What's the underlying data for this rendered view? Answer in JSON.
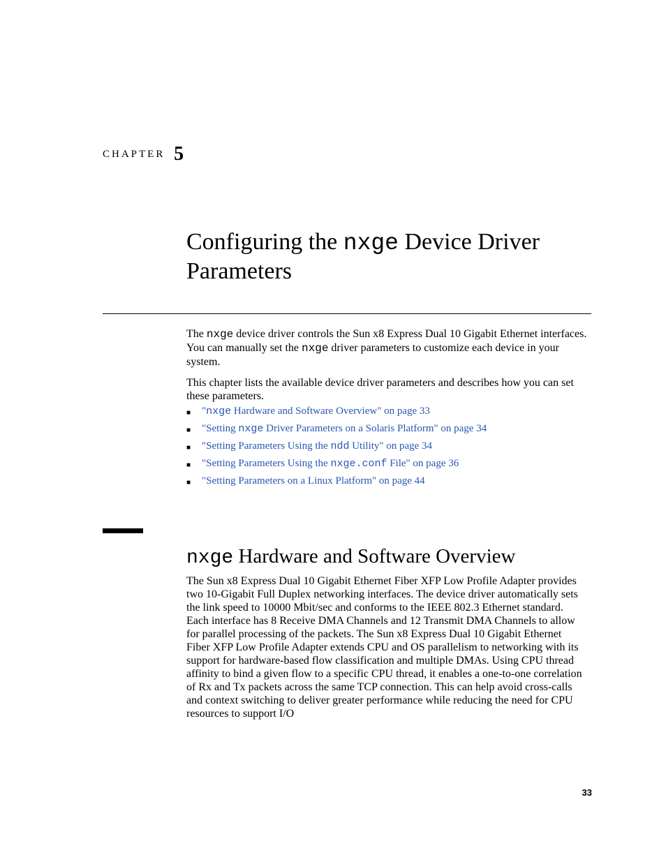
{
  "chapter": {
    "label": "CHAPTER",
    "number": "5"
  },
  "title": {
    "pre": "Configuring the ",
    "mono": "nxge",
    "post": " Device Driver Parameters"
  },
  "para1": {
    "a": "The ",
    "b": "nxge",
    "c": " device driver controls the Sun x8 Express Dual 10 Gigabit Ethernet interfaces. You can manually set the ",
    "d": "nxge",
    "e": " driver parameters to customize each device in your system."
  },
  "para2": "This chapter lists the available device driver parameters and describes how you can set these parameters.",
  "toc": [
    {
      "a": "\"",
      "b": "nxge",
      "c": " Hardware and Software Overview\" on page 33"
    },
    {
      "a": "\"Setting ",
      "b": "nxge",
      "c": " Driver Parameters on a Solaris Platform\" on page 34"
    },
    {
      "a": "\"Setting Parameters Using the ",
      "b": "ndd",
      "c": " Utility\" on page 34"
    },
    {
      "a": "\"Setting Parameters Using the ",
      "b": "nxge.conf",
      "c": " File\" on page 36"
    },
    {
      "a": "\"Setting Parameters on a Linux Platform\" on page 44",
      "b": "",
      "c": ""
    }
  ],
  "section": {
    "mono": "nxge",
    "rest": " Hardware and Software Overview"
  },
  "para3": "The Sun x8 Express Dual 10 Gigabit Ethernet Fiber XFP Low Profile Adapter provides two 10-Gigabit Full Duplex networking interfaces. The device driver automatically sets the link speed to 10000 Mbit/sec and conforms to the IEEE 802.3 Ethernet standard. Each interface has 8 Receive DMA Channels and 12 Transmit DMA Channels to allow for parallel processing of the packets. The Sun x8 Express Dual 10 Gigabit Ethernet Fiber XFP Low Profile Adapter extends CPU and OS parallelism to networking with its support for hardware-based flow classification and multiple DMAs. Using CPU thread affinity to bind a given flow to a specific CPU thread, it enables a one-to-one correlation of Rx and Tx packets across the same TCP connection. This can help avoid cross-calls and context switching to deliver greater performance while reducing the need for CPU resources to support I/O",
  "pageNumber": "33"
}
